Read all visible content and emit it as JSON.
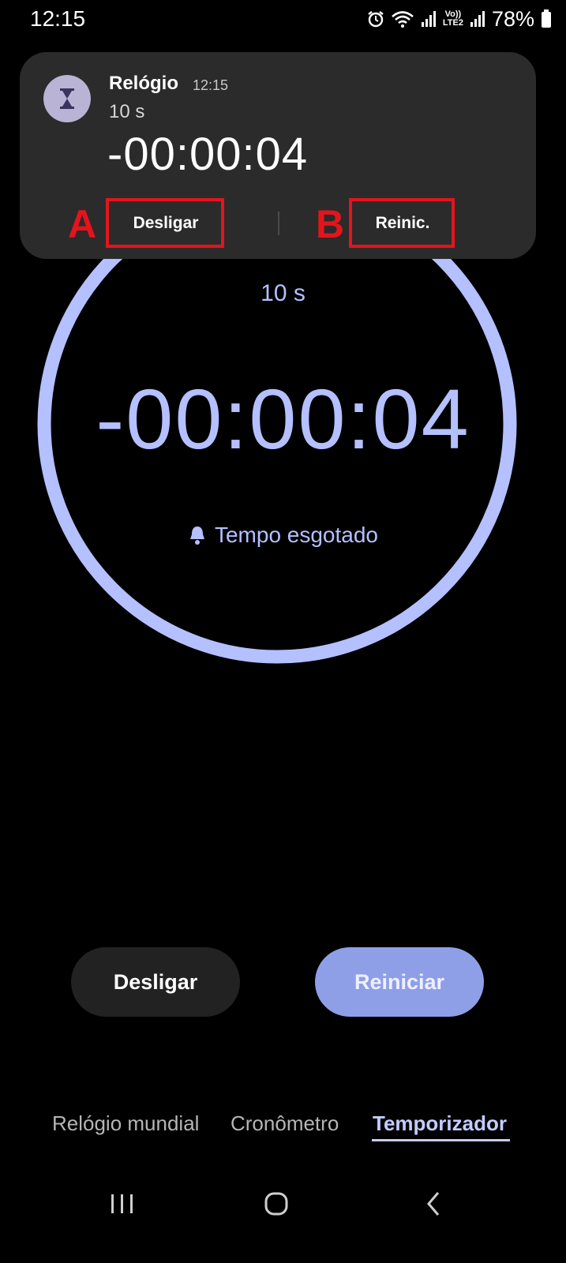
{
  "status_bar": {
    "time": "12:15",
    "battery_percent": "78%",
    "icons": [
      "alarm-icon",
      "wifi-icon",
      "signal-icon",
      "volte-icon",
      "signal-icon",
      "battery-icon"
    ],
    "volte_label": "Vo))",
    "lte_label": "LTE2"
  },
  "notification": {
    "app_name": "Relógio",
    "timestamp": "12:15",
    "subtitle": "10 s",
    "time": "-00:00:04",
    "icon": "hourglass-icon",
    "actions": [
      "Desligar",
      "Reinic."
    ]
  },
  "annotations": {
    "a_letter": "A",
    "b_letter": "B",
    "color": "#e5141c"
  },
  "timer": {
    "duration": "10 s",
    "time": "-00:00:04",
    "status": "Tempo esgotado",
    "ring_color": "#b4c0ff"
  },
  "buttons": {
    "dismiss": "Desligar",
    "restart": "Reiniciar"
  },
  "tabs": {
    "items": [
      "Relógio mundial",
      "Cronômetro",
      "Temporizador"
    ],
    "active": "Temporizador"
  },
  "nav_bar": [
    "recent-apps-icon",
    "home-icon",
    "back-icon"
  ]
}
